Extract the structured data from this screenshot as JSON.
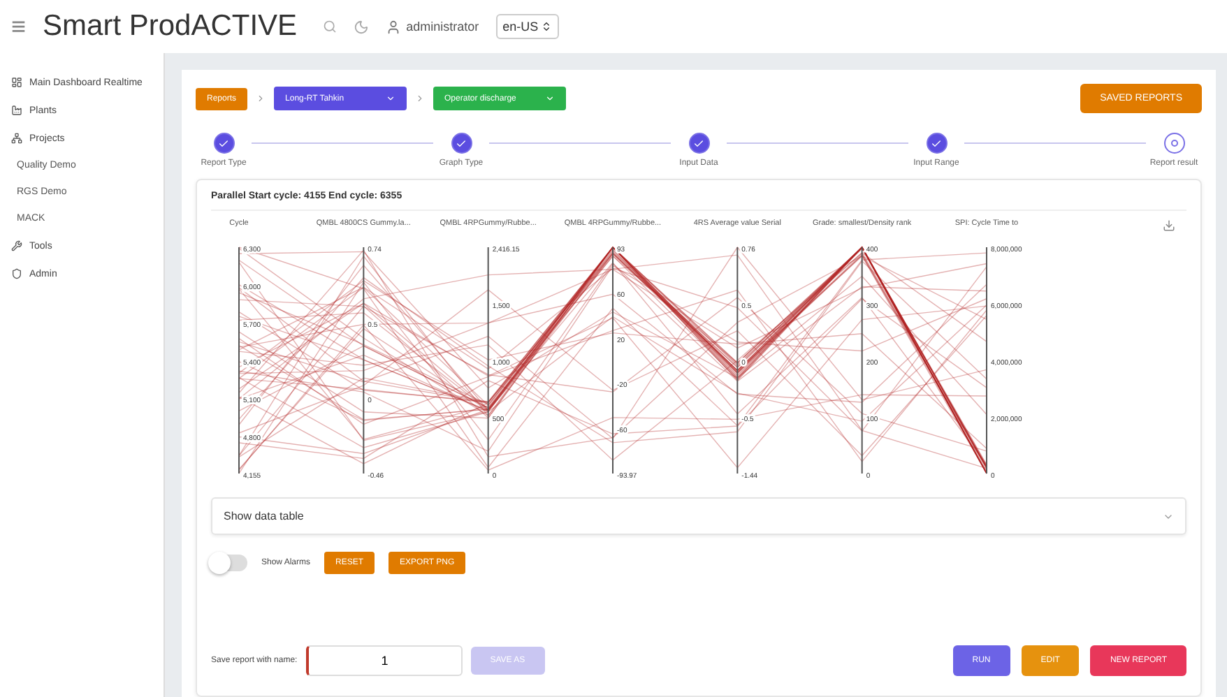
{
  "header": {
    "menu_icon": "≡",
    "title": "Smart ProdACTIVE",
    "user": "administrator",
    "language": "en-US"
  },
  "sidebar": {
    "items": [
      {
        "label": "Main Dashboard Realtime"
      },
      {
        "label": "Plants"
      },
      {
        "label": "Projects",
        "children": [
          {
            "label": "Quality Demo"
          },
          {
            "label": "RGS Demo"
          },
          {
            "label": "MACK"
          }
        ]
      },
      {
        "label": "Tools"
      },
      {
        "label": "Admin"
      }
    ]
  },
  "breadcrumb": [
    {
      "kind": "chip",
      "label": "Reports",
      "color": "#e07b00"
    },
    {
      "kind": "select",
      "label": "Long-RT Tahkin",
      "color": "#5b4de0"
    },
    {
      "kind": "select",
      "label": "Operator discharge",
      "color": "#2bb24c"
    }
  ],
  "saved_reports_button": "SAVED REPORTS",
  "stepper": [
    {
      "label": "Report Type",
      "completed": true
    },
    {
      "label": "Graph Type",
      "completed": true
    },
    {
      "label": "Input Data",
      "completed": true
    },
    {
      "label": "Input Range",
      "completed": true
    },
    {
      "label": "Report result",
      "completed": false
    }
  ],
  "report": {
    "title": "Parallel  Start cycle: 4155  End cycle: 6355",
    "axes": [
      {
        "title": "Cycle",
        "ticks": [
          "6,300",
          "6,000",
          "5,700",
          "5,400",
          "5,100",
          "4,800",
          "4,155"
        ]
      },
      {
        "title": "QMBL 4800CS Gummy.la...",
        "ticks": [
          "0.74",
          "0.5",
          "0",
          "-0.46"
        ]
      },
      {
        "title": "QMBL 4RPGummy/Rubbe...",
        "ticks": [
          "2,416.15",
          "1,500",
          "1,000",
          "500",
          "0"
        ]
      },
      {
        "title": "QMBL 4RPGummy/Rubbe...",
        "ticks": [
          "93",
          "60",
          "20",
          "-20",
          "-60",
          "-93.97"
        ]
      },
      {
        "title": "4RS Average value Serial",
        "ticks": [
          "0.76",
          "0.5",
          "0",
          "-0.5",
          "-1.44"
        ]
      },
      {
        "title": "Grade: smallest/Density rank",
        "ticks": [
          "400",
          "300",
          "200",
          "100",
          "0"
        ]
      },
      {
        "title": "SPI: Cycle Time to",
        "ticks": [
          "8,000,000",
          "6,000,000",
          "4,000,000",
          "2,000,000",
          "0"
        ]
      }
    ],
    "data_table_label": "Show data table",
    "show_alarms": {
      "label": "Show Alarms",
      "on": false
    },
    "chart_buttons": [
      "RESET",
      "EXPORT PNG"
    ],
    "save_label": "Save report with name:",
    "save_value": "1",
    "save_as": {
      "label": "SAVE AS",
      "disabled": true
    },
    "actions": [
      {
        "label": "RUN",
        "color": "#6c63e6"
      },
      {
        "label": "EDIT",
        "color": "#e6920e"
      },
      {
        "label": "NEW REPORT",
        "color": "#e8375a"
      }
    ]
  }
}
